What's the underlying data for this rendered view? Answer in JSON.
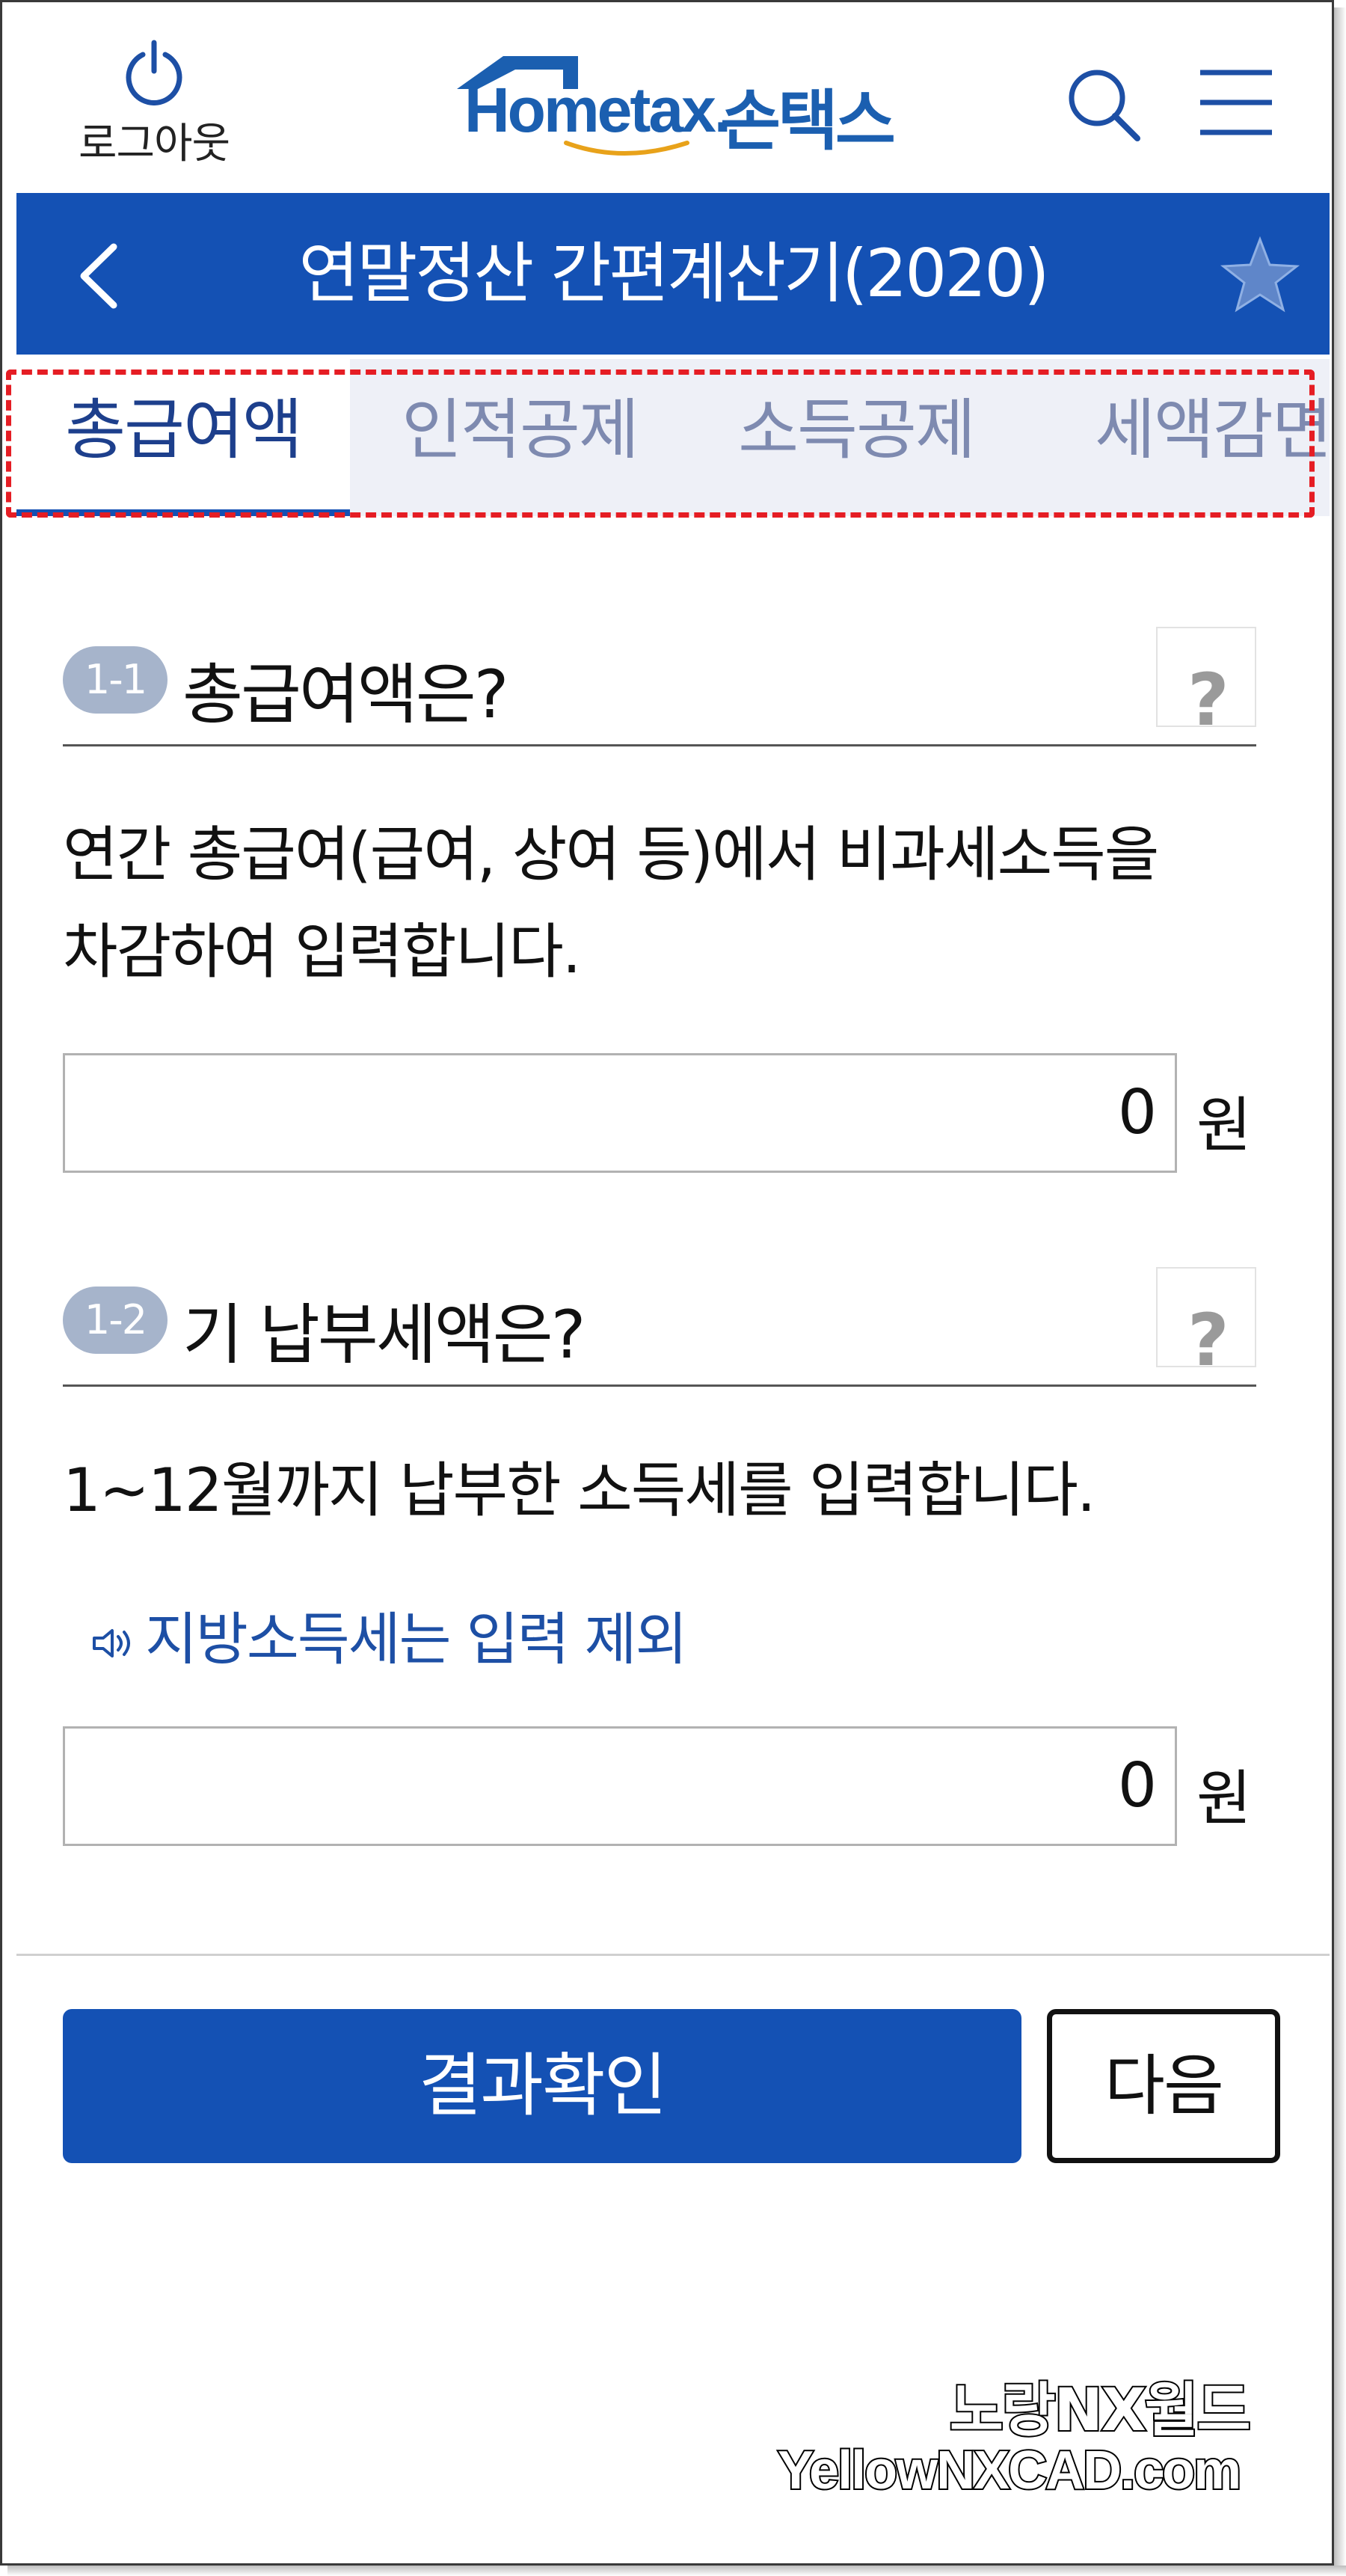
{
  "header": {
    "logout_label": "로그아웃",
    "brand_latin": "Hometax.",
    "brand_korean": "손택스",
    "brand_color": "#1b5fb0"
  },
  "titlebar": {
    "title": "연말정산 간편계산기(2020)",
    "color": "#1451b4"
  },
  "tabs": [
    {
      "label": "총급여액",
      "active": true
    },
    {
      "label": "인적공제",
      "active": false
    },
    {
      "label": "소득공제",
      "active": false
    },
    {
      "label": "세액감면",
      "active": false
    }
  ],
  "sections": [
    {
      "badge": "1-1",
      "title": "총급여액은?",
      "help": "?",
      "description_line1": "연간 총급여(급여, 상여 등)에서 비과세소득을",
      "description_line2": "차감하여 입력합니다.",
      "value": "0",
      "unit": "원"
    },
    {
      "badge": "1-2",
      "title": "기 납부세액은?",
      "help": "?",
      "description_line1": "1~12월까지 납부한 소득세를 입력합니다.",
      "notice": "지방소득세는 입력 제외",
      "value": "0",
      "unit": "원"
    }
  ],
  "actions": {
    "result_label": "결과확인",
    "next_label": "다음"
  },
  "watermark": {
    "line1": "노랑NX월드",
    "line2": "YellowNXCAD.com"
  },
  "icons": [
    "power-icon",
    "search-icon",
    "menu-icon",
    "back-arrow-icon",
    "star-icon",
    "speaker-icon",
    "house-roof-icon"
  ]
}
